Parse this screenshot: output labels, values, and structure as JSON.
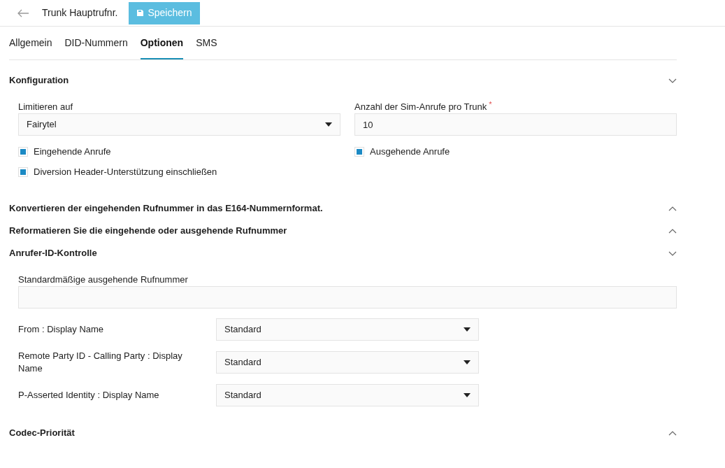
{
  "header": {
    "title": "Trunk Hauptrufnr.",
    "save_button": "Speichern"
  },
  "tabs": [
    {
      "label": "Allgemein",
      "selected": false
    },
    {
      "label": "DID-Nummern",
      "selected": false
    },
    {
      "label": "Optionen",
      "selected": true
    },
    {
      "label": "SMS",
      "selected": false
    }
  ],
  "sections": [
    {
      "title": "Konfiguration",
      "expanded": true,
      "fields": [
        {
          "kind": "select",
          "label": "Limitieren auf",
          "value": "Fairytel"
        },
        {
          "kind": "input",
          "label": "Anzahl der Sim-Anrufe pro Trunk",
          "required_mark": "*",
          "value": "10"
        }
      ],
      "checkboxes": [
        {
          "label": "Eingehende Anrufe",
          "checked": true
        },
        {
          "label": "Ausgehende Anrufe",
          "checked": true
        },
        {
          "label": "Diversion Header-Unterstützung einschließen",
          "checked": true
        }
      ]
    },
    {
      "title": "Konvertieren der eingehenden Rufnummer in das E164-Nummernformat.",
      "expanded": false
    },
    {
      "title": "Reformatieren Sie die eingehende oder ausgehende Rufnummer",
      "expanded": false
    },
    {
      "title": "Anrufer-ID-Kontrolle",
      "expanded": true,
      "fields": [
        {
          "kind": "input",
          "label": "Standardmäßige ausgehende Rufnummer"
        }
      ],
      "rows": [
        {
          "label": "From : Display Name",
          "value": "Standard"
        },
        {
          "label": "Remote Party ID - Calling Party : Display Name",
          "value": "Standard"
        },
        {
          "label": "P-Asserted Identity : Display Name",
          "value": "Standard"
        }
      ]
    },
    {
      "title": "Codec-Priorität",
      "expanded": false
    }
  ]
}
